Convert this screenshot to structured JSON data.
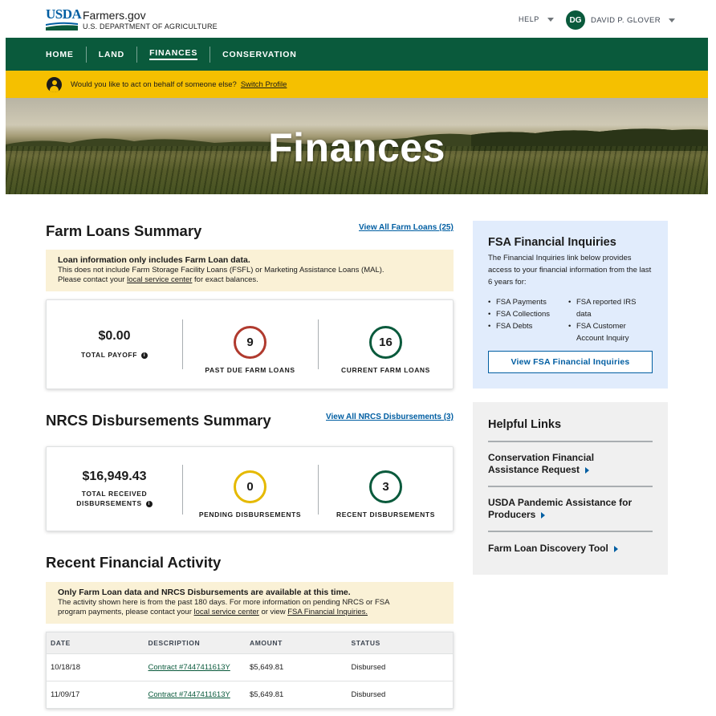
{
  "header": {
    "logo_usda": "USDA",
    "site_name": "Farmers.gov",
    "department": "U.S. DEPARTMENT OF AGRICULTURE",
    "help_label": "HELP",
    "user_initials": "DG",
    "user_name": "DAVID P. GLOVER"
  },
  "nav": {
    "items": [
      "HOME",
      "LAND",
      "FINANCES",
      "CONSERVATION"
    ],
    "active": "FINANCES"
  },
  "switch_profile": {
    "message": "Would you like to act on behalf of someone else?",
    "link": "Switch Profile"
  },
  "hero": {
    "title": "Finances"
  },
  "farm_loans": {
    "title": "Farm Loans Summary",
    "view_all": "View All Farm Loans (25)",
    "notice_bold": "Loan information only includes Farm Loan data.",
    "notice_line2": "This does not include Farm Storage Facility Loans (FSFL) or Marketing Assistance Loans (MAL).",
    "notice_line3_pre": "Please contact your",
    "notice_link": "local service center",
    "notice_line3_post": "for exact balances.",
    "total_payoff_value": "$0.00",
    "total_payoff_label": "TOTAL PAYOFF",
    "past_due_value": "9",
    "past_due_label": "PAST DUE FARM LOANS",
    "current_value": "16",
    "current_label": "CURRENT FARM LOANS"
  },
  "nrcs": {
    "title": "NRCS Disbursements Summary",
    "view_all": "View All NRCS Disbursements (3)",
    "total_value": "$16,949.43",
    "total_label_1": "TOTAL RECEIVED",
    "total_label_2": "DISBURSEMENTS",
    "pending_value": "0",
    "pending_label": "PENDING DISBURSEMENTS",
    "recent_value": "3",
    "recent_label": "RECENT DISBURSEMENTS"
  },
  "recent_activity": {
    "title": "Recent Financial Activity",
    "notice_bold": "Only Farm Loan data and NRCS Disbursements are available at this time.",
    "notice_line2": "The activity shown here is from the past 180 days. For more information on pending NRCS or FSA",
    "notice_line3_pre": "program payments, please contact your",
    "notice_link1": "local service center",
    "notice_mid": "or view",
    "notice_link2": "FSA Financial Inquiries.",
    "columns": [
      "DATE",
      "DESCRIPTION",
      "AMOUNT",
      "STATUS"
    ],
    "rows": [
      {
        "date": "10/18/18",
        "description": "Contract #7447411613Y",
        "amount": "$5,649.81",
        "status": "Disbursed"
      },
      {
        "date": "11/09/17",
        "description": "Contract #7447411613Y",
        "amount": "$5,649.81",
        "status": "Disbursed"
      }
    ]
  },
  "fsa_inquiries": {
    "title": "FSA Financial Inquiries",
    "text": "The Financial Inquiries link below provides access to your financial information from the last 6 years for:",
    "list_left": [
      "FSA Payments",
      "FSA Collections",
      "FSA Debts"
    ],
    "list_right": [
      "FSA reported IRS data",
      "FSA Customer Account Inquiry"
    ],
    "button": "View FSA Financial Inquiries"
  },
  "helpful_links": {
    "title": "Helpful Links",
    "items": [
      "Conservation Financial Assistance Request",
      "USDA Pandemic Assistance for Producers",
      "Farm Loan Discovery Tool"
    ]
  },
  "colors": {
    "nav_green": "#0a5a3c",
    "banner_yellow": "#f5c000",
    "past_due_ring": "#b03a2e",
    "current_ring": "#0a5a3c",
    "pending_ring": "#e5b900",
    "link_blue": "#005ea2"
  }
}
